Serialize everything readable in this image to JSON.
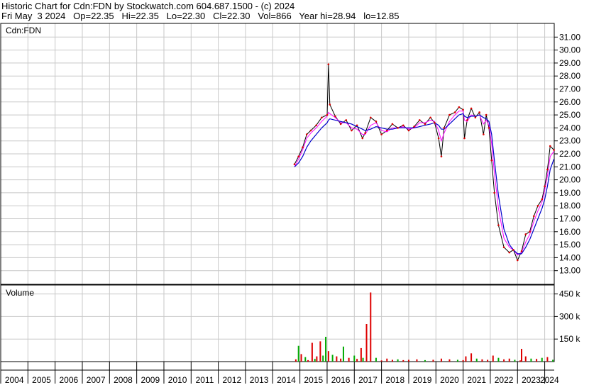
{
  "header": {
    "line1": "Historic Chart for Cdn:FDN by Stockwatch.com 604.687.1500 - (c) 2024",
    "line2": "Fri May  3 2024   Op=22.35   Hi=22.35   Lo=22.30   Cl=22.30   Vol=866   Year hi=28.94   lo=12.85"
  },
  "colors": {
    "price": "#000000",
    "ma_short": "#ff00ff",
    "ma_long": "#0000cc",
    "vol_up": "#00aa00",
    "vol_down": "#dd0000",
    "grid": "#c8c8c8"
  },
  "chart_data": [
    {
      "type": "line",
      "title": "Cdn:FDN",
      "ylim": [
        12,
        32
      ],
      "yticks": [
        "31.00",
        "30.00",
        "29.00",
        "28.00",
        "27.00",
        "26.00",
        "25.00",
        "24.00",
        "23.00",
        "22.00",
        "21.00",
        "20.00",
        "19.00",
        "18.00",
        "17.00",
        "16.00",
        "15.00",
        "14.00",
        "13.00"
      ],
      "x": [
        2014.8,
        2014.95,
        2015.1,
        2015.25,
        2015.4,
        2015.6,
        2015.8,
        2016.0,
        2016.05,
        2016.1,
        2016.3,
        2016.5,
        2016.7,
        2016.9,
        2017.1,
        2017.3,
        2017.4,
        2017.6,
        2017.8,
        2018.0,
        2018.2,
        2018.4,
        2018.6,
        2018.8,
        2019.0,
        2019.2,
        2019.4,
        2019.6,
        2019.8,
        2019.95,
        2020.1,
        2020.2,
        2020.3,
        2020.5,
        2020.7,
        2020.85,
        2021.0,
        2021.05,
        2021.15,
        2021.3,
        2021.45,
        2021.6,
        2021.75,
        2021.85,
        2021.95,
        2022.05,
        2022.15,
        2022.3,
        2022.5,
        2022.7,
        2022.85,
        2023.0,
        2023.15,
        2023.3,
        2023.45,
        2023.6,
        2023.75,
        2023.9,
        2024.0,
        2024.1,
        2024.2,
        2024.34
      ],
      "series": [
        {
          "values": [
            21.2,
            21.8,
            22.5,
            23.5,
            23.8,
            24.2,
            24.8,
            25.0,
            28.9,
            25.8,
            24.9,
            24.3,
            24.6,
            23.8,
            24.2,
            23.2,
            23.6,
            24.8,
            24.5,
            23.5,
            23.8,
            24.3,
            24.0,
            24.2,
            23.8,
            24.1,
            24.6,
            24.3,
            24.8,
            24.4,
            23.2,
            21.8,
            24.0,
            25.0,
            25.2,
            25.6,
            25.4,
            23.2,
            24.6,
            25.5,
            24.8,
            25.2,
            23.5,
            25.0,
            24.0,
            21.5,
            19.0,
            16.5,
            14.8,
            14.4,
            14.6,
            13.8,
            14.5,
            15.8,
            16.0,
            17.2,
            18.0,
            18.5,
            19.5,
            20.8,
            22.6,
            22.3
          ]
        },
        {
          "values": [
            21.0,
            21.6,
            22.3,
            23.2,
            23.6,
            24.0,
            24.5,
            24.9,
            25.2,
            25.1,
            24.8,
            24.4,
            24.4,
            24.0,
            23.9,
            23.5,
            23.5,
            24.2,
            24.4,
            23.8,
            23.7,
            24.0,
            24.0,
            24.1,
            23.9,
            24.0,
            24.4,
            24.4,
            24.6,
            24.5,
            23.8,
            23.0,
            23.6,
            24.5,
            25.0,
            25.3,
            25.3,
            24.6,
            24.5,
            25.0,
            24.9,
            25.0,
            24.3,
            24.6,
            24.2,
            22.8,
            20.5,
            17.8,
            15.5,
            14.8,
            14.6,
            14.2,
            14.4,
            15.2,
            15.8,
            16.8,
            17.6,
            18.3,
            19.2,
            20.3,
            21.8,
            22.2
          ]
        },
        {
          "values": [
            21.0,
            21.3,
            21.8,
            22.5,
            23.0,
            23.5,
            24.0,
            24.4,
            24.6,
            24.7,
            24.6,
            24.5,
            24.4,
            24.3,
            24.1,
            23.9,
            23.8,
            23.9,
            24.1,
            24.0,
            23.9,
            23.9,
            24.0,
            24.0,
            24.0,
            24.0,
            24.1,
            24.2,
            24.3,
            24.4,
            24.2,
            23.9,
            23.9,
            24.3,
            24.7,
            25.0,
            25.1,
            24.9,
            24.8,
            24.9,
            24.9,
            25.0,
            24.8,
            24.7,
            24.5,
            23.5,
            21.5,
            18.8,
            16.2,
            15.0,
            14.6,
            14.3,
            14.3,
            14.8,
            15.4,
            16.2,
            17.0,
            17.8,
            18.5,
            19.5,
            20.8,
            21.6
          ]
        }
      ]
    },
    {
      "type": "bar",
      "title": "Volume",
      "ylim": [
        0,
        500
      ],
      "yticks": [
        "450 k",
        "300 k",
        "150 k"
      ],
      "ytick_values": [
        450,
        300,
        150
      ],
      "xticks": [
        "2004",
        "2005",
        "2006",
        "2007",
        "2008",
        "2009",
        "2010",
        "2011",
        "2012",
        "2013",
        "2014",
        "2015",
        "2016",
        "2017",
        "2018",
        "2019",
        "2020",
        "2021",
        "2022",
        "2023",
        "2024"
      ],
      "x": [
        2014.85,
        2014.95,
        2015.05,
        2015.2,
        2015.3,
        2015.45,
        2015.55,
        2015.62,
        2015.75,
        2015.85,
        2015.95,
        2016.05,
        2016.2,
        2016.35,
        2016.5,
        2016.6,
        2016.8,
        2017.0,
        2017.1,
        2017.25,
        2017.32,
        2017.45,
        2017.6,
        2017.8,
        2018.0,
        2018.2,
        2018.4,
        2018.6,
        2018.8,
        2019.0,
        2019.3,
        2019.6,
        2019.9,
        2020.2,
        2020.5,
        2020.8,
        2021.0,
        2021.1,
        2021.3,
        2021.5,
        2021.7,
        2021.9,
        2022.1,
        2022.3,
        2022.5,
        2022.7,
        2022.9,
        2023.1,
        2023.15,
        2023.3,
        2023.5,
        2023.7,
        2023.9,
        2024.1,
        2024.3
      ],
      "values": [
        15,
        105,
        50,
        30,
        10,
        125,
        18,
        35,
        135,
        40,
        165,
        70,
        45,
        35,
        20,
        100,
        25,
        40,
        18,
        90,
        25,
        250,
        460,
        25,
        8,
        20,
        12,
        15,
        10,
        12,
        15,
        10,
        12,
        20,
        15,
        12,
        10,
        35,
        55,
        20,
        15,
        12,
        40,
        25,
        15,
        20,
        12,
        8,
        85,
        35,
        20,
        18,
        25,
        30,
        12
      ],
      "colors": [
        "red",
        "green",
        "red",
        "green",
        "red",
        "red",
        "green",
        "red",
        "red",
        "green",
        "green",
        "red",
        "green",
        "red",
        "red",
        "green",
        "red",
        "green",
        "red",
        "red",
        "green",
        "red",
        "red",
        "green",
        "red",
        "red",
        "red",
        "green",
        "red",
        "red",
        "red",
        "green",
        "red",
        "red",
        "red",
        "green",
        "red",
        "red",
        "red",
        "green",
        "red",
        "red",
        "red",
        "green",
        "red",
        "red",
        "green",
        "red",
        "red",
        "red",
        "green",
        "red",
        "green",
        "red",
        "green"
      ]
    }
  ]
}
